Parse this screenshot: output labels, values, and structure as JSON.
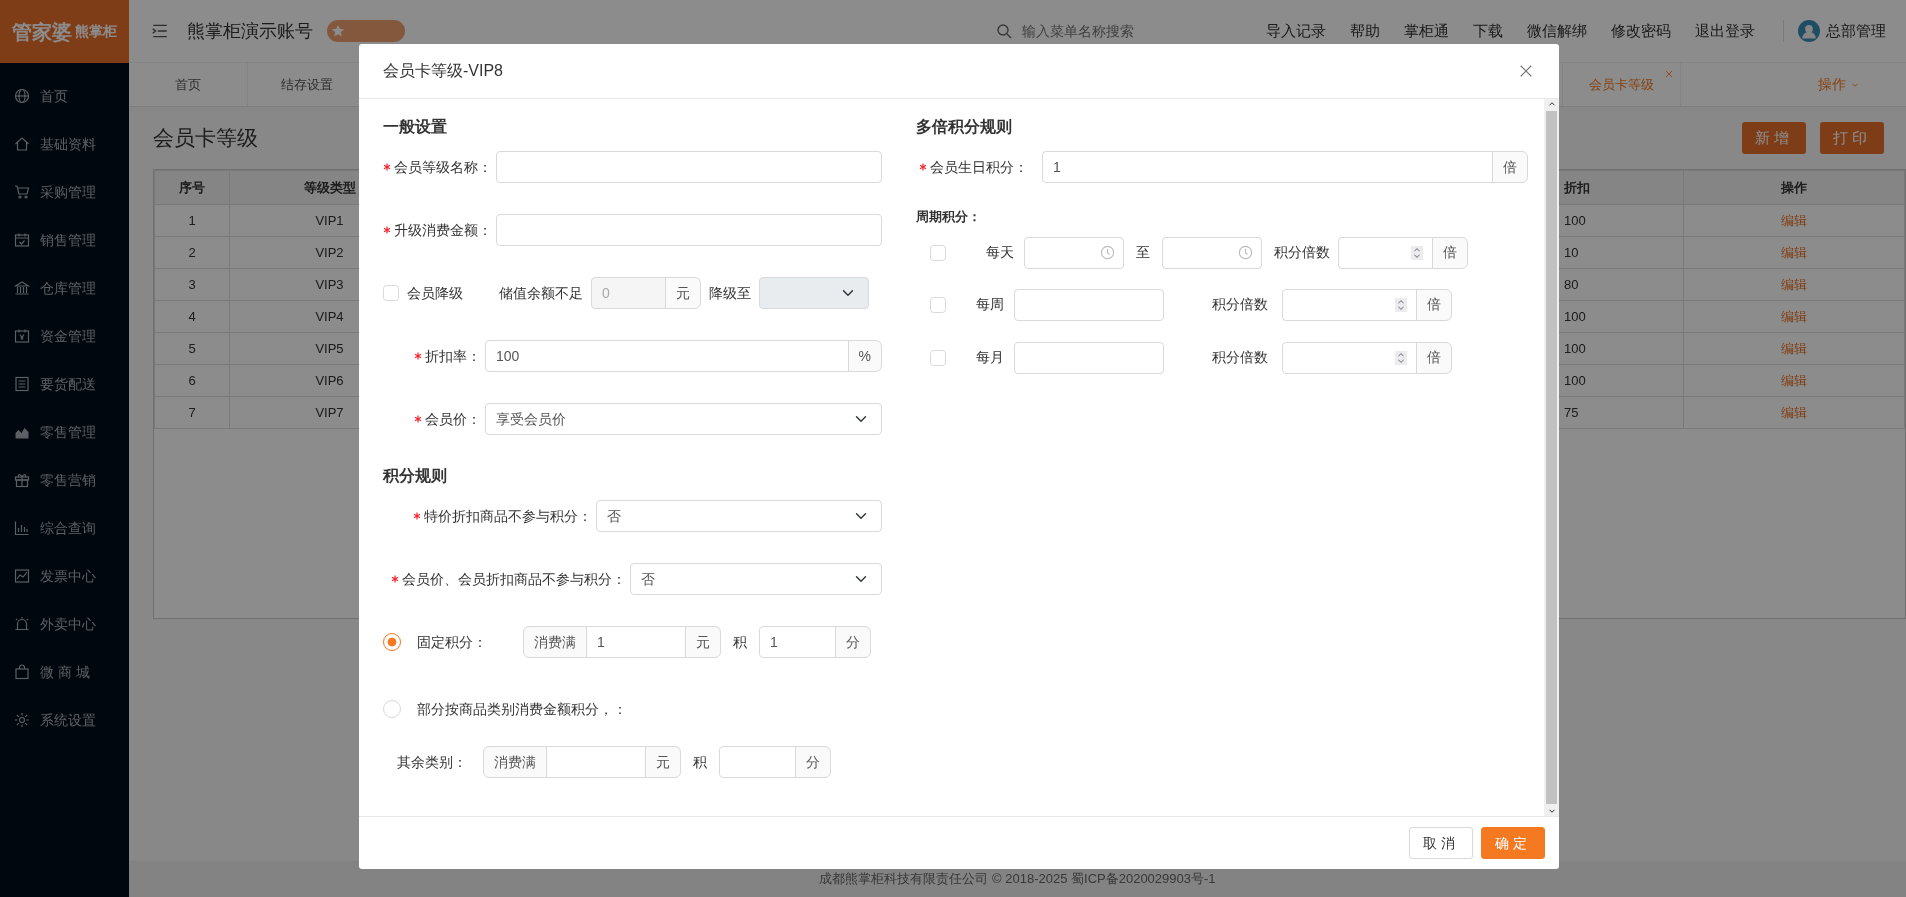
{
  "app": {
    "logo": "管家婆",
    "logo_sub": "熊掌柜",
    "account": "熊掌柜演示账号",
    "search": {
      "placeholder": "输入菜单名称搜索"
    },
    "top_links": [
      "导入记录",
      "帮助",
      "掌柜通",
      "下载",
      "微信解绑",
      "修改密码",
      "退出登录"
    ],
    "user": "总部管理"
  },
  "sidebar": {
    "items": [
      {
        "label": "首页",
        "selected": false
      },
      {
        "label": "基础资料",
        "selected": false
      },
      {
        "label": "采购管理",
        "selected": false
      },
      {
        "label": "销售管理",
        "selected": false
      },
      {
        "label": "仓库管理",
        "selected": false
      },
      {
        "label": "资金管理",
        "selected": false
      },
      {
        "label": "要货配送",
        "selected": false
      },
      {
        "label": "零售管理",
        "selected": false
      },
      {
        "label": "零售营销",
        "selected": false
      },
      {
        "label": "综合查询",
        "selected": false
      },
      {
        "label": "发票中心",
        "selected": false
      },
      {
        "label": "外卖中心",
        "selected": false
      },
      {
        "label": "微 商 城",
        "selected": false
      },
      {
        "label": "系统设置",
        "selected": false
      }
    ]
  },
  "tabs": [
    {
      "label": "首页",
      "selected": false,
      "closable": false
    },
    {
      "label": "结存设置",
      "selected": false,
      "closable": false
    },
    {
      "label": "会员卡等级",
      "selected": true,
      "closable": true
    }
  ],
  "tab_menu": "操作",
  "page": {
    "title": "会员卡等级",
    "buttons": [
      "新增",
      "打印"
    ],
    "table": {
      "columns": [
        "序号",
        "等级类型",
        "折扣",
        "操作"
      ],
      "rows": [
        [
          "1",
          "VIP1",
          "100",
          "编辑"
        ],
        [
          "2",
          "VIP2",
          "10",
          "编辑"
        ],
        [
          "3",
          "VIP3",
          "80",
          "编辑"
        ],
        [
          "4",
          "VIP4",
          "100",
          "编辑"
        ],
        [
          "5",
          "VIP5",
          "100",
          "编辑"
        ],
        [
          "6",
          "VIP6",
          "100",
          "编辑"
        ],
        [
          "7",
          "VIP7",
          "75",
          "编辑"
        ]
      ]
    }
  },
  "footer": "成都熊掌柜科技有限责任公司 © 2018-2025 蜀ICP备2020029903号-1",
  "modal": {
    "title": "会员卡等级-VIP8",
    "general": {
      "heading": "一般设置",
      "fields": [
        {
          "kind": "text",
          "label": "会员等级名称：",
          "required": true
        },
        {
          "kind": "text",
          "label": "升级消费金额：",
          "required": true
        },
        {
          "kind": "downgrade",
          "label": "会员降级",
          "checked": false,
          "threshold_label": "储值余额不足",
          "value": "0",
          "unit": "元",
          "disabled": true,
          "target_label": "降级至"
        },
        {
          "kind": "addon",
          "label": "折扣率：",
          "required": true,
          "value": "100",
          "unit": "%"
        },
        {
          "kind": "select",
          "label": "会员价：",
          "required": true,
          "value": "享受会员价"
        }
      ]
    },
    "points": {
      "heading": "积分规则",
      "fields": [
        {
          "kind": "select",
          "label": "特价折扣商品不参与积分：",
          "required": true,
          "value": "否"
        },
        {
          "kind": "select",
          "label": "会员价、会员折扣商品不参与积分：",
          "required": true,
          "value": "否"
        }
      ],
      "options": [
        {
          "label": "固定积分：",
          "selected": true,
          "rule": {
            "prefix": "消费满",
            "amount": "1",
            "unit": "元",
            "earn_label": "积",
            "points": "1",
            "points_unit": "分"
          }
        },
        {
          "label": "部分按商品类别消费金额积分，：",
          "selected": false
        }
      ],
      "other": {
        "label": "其余类别：",
        "rule": {
          "prefix": "消费满",
          "unit": "元",
          "earn_label": "积",
          "points_unit": "分"
        }
      }
    },
    "multiplier": {
      "heading": "多倍积分规则",
      "birthday": {
        "label": "会员生日积分：",
        "required": true,
        "value": "1",
        "unit": "倍"
      },
      "period_heading": "周期积分：",
      "periods": [
        {
          "kind": "range",
          "label": "每天",
          "checked": false,
          "to_label": "至",
          "multiplier_label": "积分倍数",
          "unit": "倍"
        },
        {
          "kind": "single",
          "label": "每周",
          "checked": false,
          "multiplier_label": "积分倍数",
          "unit": "倍"
        },
        {
          "kind": "single",
          "label": "每月",
          "checked": false,
          "multiplier_label": "积分倍数",
          "unit": "倍"
        }
      ]
    },
    "buttons": [
      {
        "label": "取消",
        "kind": "secondary"
      },
      {
        "label": "确定",
        "kind": "primary"
      }
    ]
  }
}
